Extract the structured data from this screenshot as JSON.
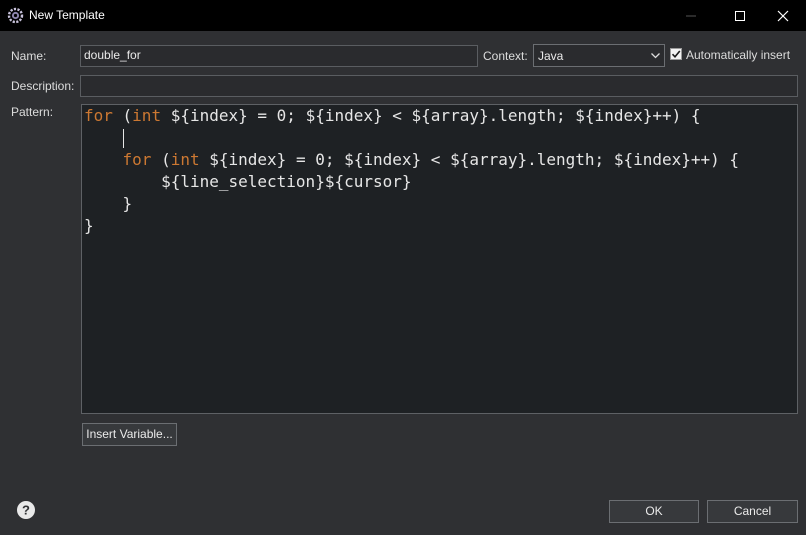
{
  "window": {
    "title": "New Template",
    "icon": "eclipse-gear-icon",
    "controls": [
      "minimize-icon",
      "maximize-icon",
      "close-icon"
    ]
  },
  "form": {
    "name_label": "Name:",
    "name_value": "double_for",
    "context_label": "Context:",
    "context_value": "Java",
    "auto_insert_label": "Automatically insert",
    "auto_insert_checked": true,
    "description_label": "Description:",
    "description_value": "",
    "pattern_label": "Pattern:"
  },
  "pattern": {
    "lines": [
      [
        [
          "for",
          "#cc7832"
        ],
        [
          " (",
          "#e6e6e6"
        ],
        [
          "int",
          "#cc7832"
        ],
        [
          " ${index} = 0; ${index} < ${array}.length; ${index}++) {",
          "#e6e6e6"
        ]
      ],
      [
        [
          "",
          "#e6e6e6"
        ]
      ],
      [
        [
          "    ",
          "#e6e6e6"
        ],
        [
          "for",
          "#cc7832"
        ],
        [
          " (",
          "#e6e6e6"
        ],
        [
          "int",
          "#cc7832"
        ],
        [
          " ${index} = 0; ${index} < ${array}.length; ${index}++) {",
          "#e6e6e6"
        ]
      ],
      [
        [
          "        ${line_selection}${cursor}",
          "#e6e6e6"
        ]
      ],
      [
        [
          "    }",
          "#e6e6e6"
        ]
      ],
      [
        [
          "}",
          "#e6e6e6"
        ]
      ]
    ]
  },
  "buttons": {
    "insert_variable": "Insert Variable...",
    "ok": "OK",
    "cancel": "Cancel"
  },
  "colors": {
    "keyword": "#cc7832",
    "code_text": "#e6e6e6",
    "editor_bg": "#1e2124",
    "dialog_bg": "#2f3033",
    "titlebar_bg": "#000000"
  }
}
